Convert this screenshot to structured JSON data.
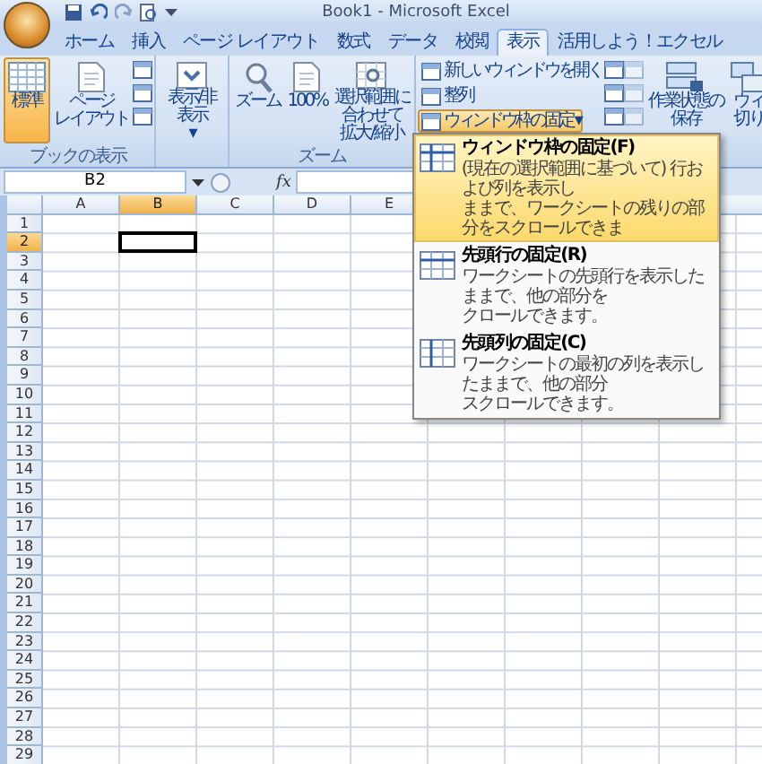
{
  "window": {
    "title": "Book1 - Microsoft Excel"
  },
  "tabs": [
    {
      "label": "ホーム",
      "selected": false
    },
    {
      "label": "挿入",
      "selected": false
    },
    {
      "label": "ページ レイアウト",
      "selected": false
    },
    {
      "label": "数式",
      "selected": false
    },
    {
      "label": "データ",
      "selected": false
    },
    {
      "label": "校閲",
      "selected": false
    },
    {
      "label": "表示",
      "selected": true
    },
    {
      "label": "活用しよう！エクセル",
      "selected": false
    }
  ],
  "ribbon": {
    "groups": [
      {
        "label": "ブックの表示",
        "buttons": [
          {
            "kind": "large",
            "lines": [
              "標準"
            ],
            "selected": true
          },
          {
            "kind": "large",
            "lines": [
              "ページ",
              "レイアウト"
            ],
            "selected": false
          },
          {
            "kind": "icons",
            "disabled": false
          }
        ]
      },
      {
        "buttons": [
          {
            "kind": "large",
            "lines": [
              "表示/非表示"
            ],
            "caret": "▾",
            "selected": false
          }
        ]
      },
      {
        "label": "ズーム",
        "buttons": [
          {
            "kind": "large",
            "lines": [
              "ズーム"
            ],
            "selected": false
          },
          {
            "kind": "large",
            "lines": [
              "100%"
            ],
            "selected": false
          },
          {
            "kind": "large",
            "lines": [
              "選択範囲に合わせて",
              "拡大/縮小"
            ],
            "selected": false
          }
        ]
      },
      {
        "buttons": [
          {
            "kind": "small",
            "items": [
              {
                "label": "新しいウィンドウを開く",
                "expanded": false
              },
              {
                "label": "整列",
                "expanded": false
              },
              {
                "label": "ウィンドウ枠の固定",
                "caret": "▾",
                "expanded": true
              }
            ]
          },
          {
            "kind": "icons",
            "disabled": false
          },
          {
            "kind": "icons",
            "disabled": true
          },
          {
            "kind": "large",
            "lines": [
              "作業状態の",
              "保存"
            ],
            "selected": false
          },
          {
            "kind": "large",
            "lines": [
              "ウィ",
              "切り"
            ],
            "selected": false
          }
        ]
      }
    ]
  },
  "freeze_menu": {
    "items": [
      {
        "title": "ウィンドウ枠の固定(F)",
        "description_lines": [
          "(現在の選択範囲に基づいて) 行および列を表示し",
          "ままで、ワークシートの残りの部分をスクロールできま"
        ],
        "selected": true
      },
      {
        "title": "先頭行の固定(R)",
        "description_lines": [
          "ワークシートの先頭行を表示したままで、他の部分を",
          "クロールできます。"
        ],
        "selected": false
      },
      {
        "title": "先頭列の固定(C)",
        "description_lines": [
          "ワークシートの最初の列を表示したままで、他の部分",
          "スクロールできます。"
        ],
        "selected": false
      }
    ]
  },
  "formula_bar": {
    "name_box": "B2",
    "fx": "fx"
  },
  "sheet": {
    "columns": [
      {
        "label": "A",
        "selected": false
      },
      {
        "label": "B",
        "selected": true
      },
      {
        "label": "C",
        "selected": false
      },
      {
        "label": "D",
        "selected": false
      },
      {
        "label": "E",
        "selected": false
      }
    ],
    "rows": [
      {
        "label": "1",
        "selected": false
      },
      {
        "label": "2",
        "selected": true
      },
      {
        "label": "3",
        "selected": false
      },
      {
        "label": "4",
        "selected": false
      },
      {
        "label": "5",
        "selected": false
      },
      {
        "label": "6",
        "selected": false
      },
      {
        "label": "7",
        "selected": false
      },
      {
        "label": "8",
        "selected": false
      },
      {
        "label": "9",
        "selected": false
      },
      {
        "label": "10",
        "selected": false
      },
      {
        "label": "11",
        "selected": false
      },
      {
        "label": "12",
        "selected": false
      },
      {
        "label": "13",
        "selected": false
      },
      {
        "label": "14",
        "selected": false
      },
      {
        "label": "15",
        "selected": false
      },
      {
        "label": "16",
        "selected": false
      },
      {
        "label": "17",
        "selected": false
      },
      {
        "label": "18",
        "selected": false
      },
      {
        "label": "19",
        "selected": false
      },
      {
        "label": "20",
        "selected": false
      },
      {
        "label": "21",
        "selected": false
      },
      {
        "label": "22",
        "selected": false
      },
      {
        "label": "23",
        "selected": false
      },
      {
        "label": "24",
        "selected": false
      },
      {
        "label": "25",
        "selected": false
      },
      {
        "label": "26",
        "selected": false
      },
      {
        "label": "27",
        "selected": false
      },
      {
        "label": "28",
        "selected": false
      },
      {
        "label": "29",
        "selected": false
      }
    ]
  }
}
